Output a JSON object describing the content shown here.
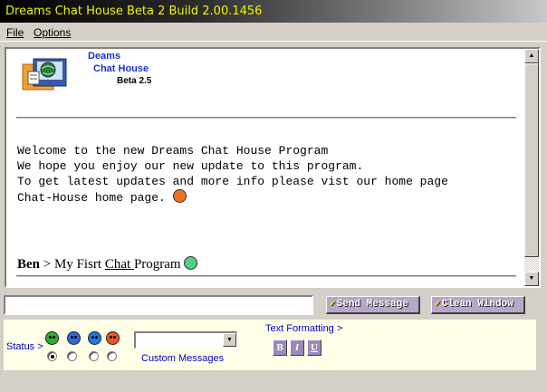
{
  "window": {
    "title": "Dreams Chat House Beta 2 Build 2.00.1456"
  },
  "menu": {
    "file": "File",
    "options": "Options"
  },
  "logo": {
    "line1": "Deams",
    "line2": "Chat House",
    "line3": "Beta 2.5"
  },
  "welcome_lines": [
    "Welcome to the new Dreams Chat House Program",
    "We hope you enjoy our new update to this program.",
    "To get latest updates and more info please vist our home page",
    "Chat-House home page."
  ],
  "chat": {
    "sender": "Ben",
    "separator": " > ",
    "message_pre": "My Fisrt ",
    "message_link": "Chat ",
    "message_post": "Program"
  },
  "input": {
    "value": "",
    "placeholder": ""
  },
  "buttons": {
    "send": "Send Message",
    "clear": "Clean Window"
  },
  "status": {
    "label": "Status >",
    "faces": [
      {
        "icon": "grin-face-icon",
        "color": "#33aa33"
      },
      {
        "icon": "sad-face-icon",
        "color": "#3366dd"
      },
      {
        "icon": "cool-face-icon",
        "color": "#2277dd"
      },
      {
        "icon": "angry-face-icon",
        "color": "#ee5522"
      }
    ],
    "selected_index": 0
  },
  "custom_messages": {
    "label": "Custom Messages",
    "selected": ""
  },
  "text_formatting": {
    "label": "Text Formatting >",
    "bold": "B",
    "italic": "I",
    "underline": "U"
  },
  "colors": {
    "title_text": "#f2f200",
    "link_blue": "#0000c0",
    "button_face": "#b8a6c8",
    "panel_bg": "#ffffe8"
  }
}
